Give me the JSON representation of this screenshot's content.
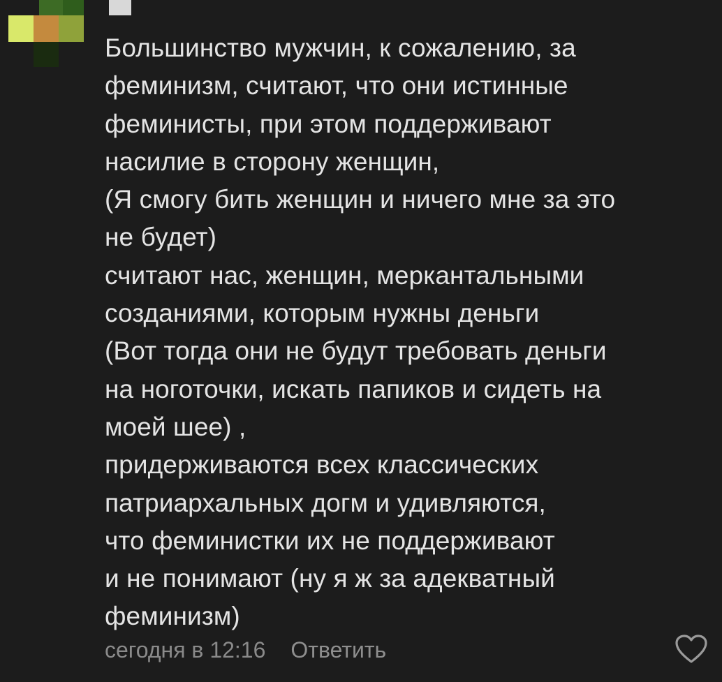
{
  "comment": {
    "author_name": "",
    "lines": [
      "Большинство мужчин, к сожалению, за",
      "феминизм, считают, что они истинные",
      "феминисты, при этом поддерживают",
      "насилие в сторону женщин,",
      "(Я смогу бить женщин и ничего мне за это",
      "не будет)",
      "считают нас, женщин, меркантальными",
      "созданиями, которым нужны деньги",
      "(Вот тогда они не будут требовать деньги",
      "на ноготочки, искать папиков и сидеть на",
      "моей шее) ,",
      "придерживаются всех классических",
      "патриархальных догм и удивляются,",
      "что феминистки их не поддерживают",
      "и не понимают (ну я ж за адекватный",
      "феминизм)"
    ]
  },
  "footer": {
    "timestamp": "сегодня в 12:16",
    "reply_label": "Ответить"
  },
  "icons": {
    "like": "heart-outline-icon",
    "avatar": "pixelated-avatar"
  },
  "colors": {
    "background": "#1c1c1c",
    "text": "#e4e4e4",
    "muted": "#8a8a8a"
  }
}
